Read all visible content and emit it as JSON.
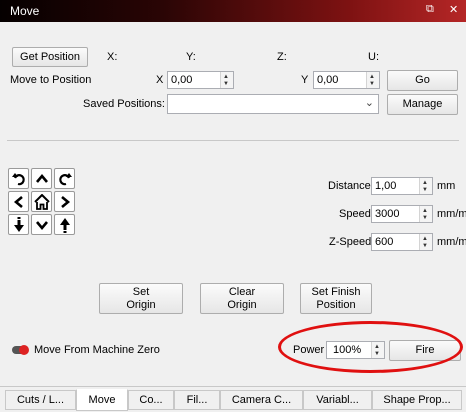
{
  "window": {
    "title": "Move",
    "restore_icon": "restore-icon",
    "close_icon": "close-icon"
  },
  "position": {
    "get_position_label": "Get Position",
    "x_label": "X:",
    "y_label": "Y:",
    "z_label": "Z:",
    "u_label": "U:",
    "move_to_label": "Move to Position",
    "x_field_label": "X",
    "x_value": "0,00",
    "y_field_label": "Y",
    "y_value": "0,00",
    "go_label": "Go",
    "saved_label": "Saved Positions:",
    "saved_value": "",
    "manage_label": "Manage"
  },
  "jog": {
    "buttons": [
      "rotate-ccw",
      "up",
      "rotate-cw",
      "left",
      "home",
      "right",
      "z-down",
      "down",
      "z-up"
    ]
  },
  "params": {
    "distance_label": "Distance",
    "distance_value": "1,00",
    "distance_unit": "mm",
    "speed_label": "Speed",
    "speed_value": "3000",
    "speed_unit": "mm/m",
    "zspeed_label": "Z-Speed",
    "zspeed_value": "600",
    "zspeed_unit": "mm/m"
  },
  "actions": {
    "set_origin": "Set\nOrigin",
    "clear_origin": "Clear\nOrigin",
    "set_finish": "Set Finish\nPosition"
  },
  "bottom": {
    "move_from_zero_label": "Move From Machine Zero",
    "power_label": "Power",
    "power_value": "100%",
    "fire_label": "Fire"
  },
  "tabs": [
    "Cuts / L...",
    "Move",
    "Co...",
    "Fil...",
    "Camera C...",
    "Variabl...",
    "Shape Prop..."
  ],
  "active_tab": "Move",
  "colors": {
    "title_gradient_end": "#b52626",
    "highlight_ellipse": "#e01010"
  }
}
